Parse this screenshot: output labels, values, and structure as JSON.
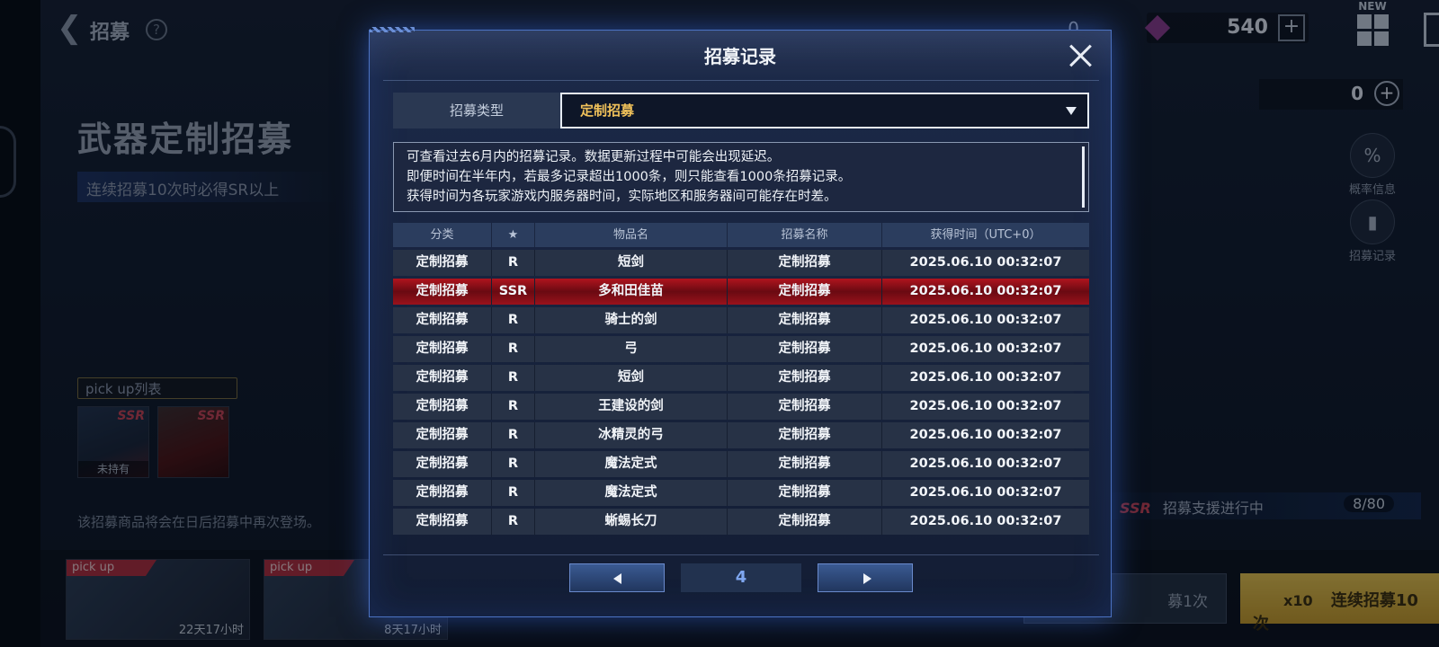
{
  "topbar": {
    "title": "招募",
    "help": "?",
    "crystal_value": "0",
    "gem_value": "540",
    "gem_plus": "+",
    "new_tag": "NEW"
  },
  "left_panel": {
    "title": "武器定制招募",
    "subtitle": "连续招募10次时必得SR以上",
    "pickup_label": "pick up列表",
    "cards": [
      {
        "rarity": "SSR",
        "status": "未持有"
      },
      {
        "rarity": "SSR",
        "status": ""
      }
    ],
    "return_note": "该招募商品将会在日后招募中再次登场。"
  },
  "right_panel": {
    "ticket_value": "0",
    "ticket_plus": "+",
    "rate_info_label": "概率信息",
    "record_label": "招募记录",
    "support_tag": "SSR",
    "support_text": "招募支援进行中",
    "support_count": "8/80"
  },
  "bottom": {
    "banners": [
      {
        "tag": "pick up",
        "timer": "22天17小时"
      },
      {
        "tag": "pick up",
        "timer": "8天17小时"
      }
    ],
    "single_label": "募1次",
    "multi_count": "x10",
    "multi_label": "连续招募10次"
  },
  "dialog": {
    "title": "招募记录",
    "type_label": "招募类型",
    "type_value": "定制招募",
    "notice_lines": [
      "可查看过去6月内的招募记录。数据更新过程中可能会出现延迟。",
      "即便时间在半年内，若最多记录超出1000条，则只能查看1000条招募记录。",
      "获得时间为各玩家游戏内服务器时间，实际地区和服务器间可能存在时差。"
    ],
    "columns": [
      "分类",
      "★",
      "物品名",
      "招募名称",
      "获得时间（UTC+0）"
    ],
    "rows": [
      {
        "category": "定制招募",
        "rarity": "R",
        "item": "短剑",
        "banner": "定制招募",
        "time": "2025.06.10 00:32:07",
        "highlight": false
      },
      {
        "category": "定制招募",
        "rarity": "SSR",
        "item": "多和田佳苗",
        "banner": "定制招募",
        "time": "2025.06.10 00:32:07",
        "highlight": true
      },
      {
        "category": "定制招募",
        "rarity": "R",
        "item": "骑士的剑",
        "banner": "定制招募",
        "time": "2025.06.10 00:32:07",
        "highlight": false
      },
      {
        "category": "定制招募",
        "rarity": "R",
        "item": "弓",
        "banner": "定制招募",
        "time": "2025.06.10 00:32:07",
        "highlight": false
      },
      {
        "category": "定制招募",
        "rarity": "R",
        "item": "短剑",
        "banner": "定制招募",
        "time": "2025.06.10 00:32:07",
        "highlight": false
      },
      {
        "category": "定制招募",
        "rarity": "R",
        "item": "王建设的剑",
        "banner": "定制招募",
        "time": "2025.06.10 00:32:07",
        "highlight": false
      },
      {
        "category": "定制招募",
        "rarity": "R",
        "item": "冰精灵的弓",
        "banner": "定制招募",
        "time": "2025.06.10 00:32:07",
        "highlight": false
      },
      {
        "category": "定制招募",
        "rarity": "R",
        "item": "魔法定式",
        "banner": "定制招募",
        "time": "2025.06.10 00:32:07",
        "highlight": false
      },
      {
        "category": "定制招募",
        "rarity": "R",
        "item": "魔法定式",
        "banner": "定制招募",
        "time": "2025.06.10 00:32:07",
        "highlight": false
      },
      {
        "category": "定制招募",
        "rarity": "R",
        "item": "蜥蜴长刀",
        "banner": "定制招募",
        "time": "2025.06.10 00:32:07",
        "highlight": false
      }
    ],
    "page": "4"
  },
  "colors": {
    "accent_blue": "#4b72c2",
    "ssr_red": "#b0141e",
    "gold": "#f0c15a"
  },
  "icons": [
    "back-arrow-icon",
    "help-icon",
    "gem-icon",
    "plus-icon",
    "grid-menu-icon",
    "exit-door-icon",
    "close-icon",
    "dropdown-caret-icon",
    "prev-arrow-icon",
    "next-arrow-icon",
    "rate-info-icon",
    "record-icon",
    "ticket-icon"
  ]
}
